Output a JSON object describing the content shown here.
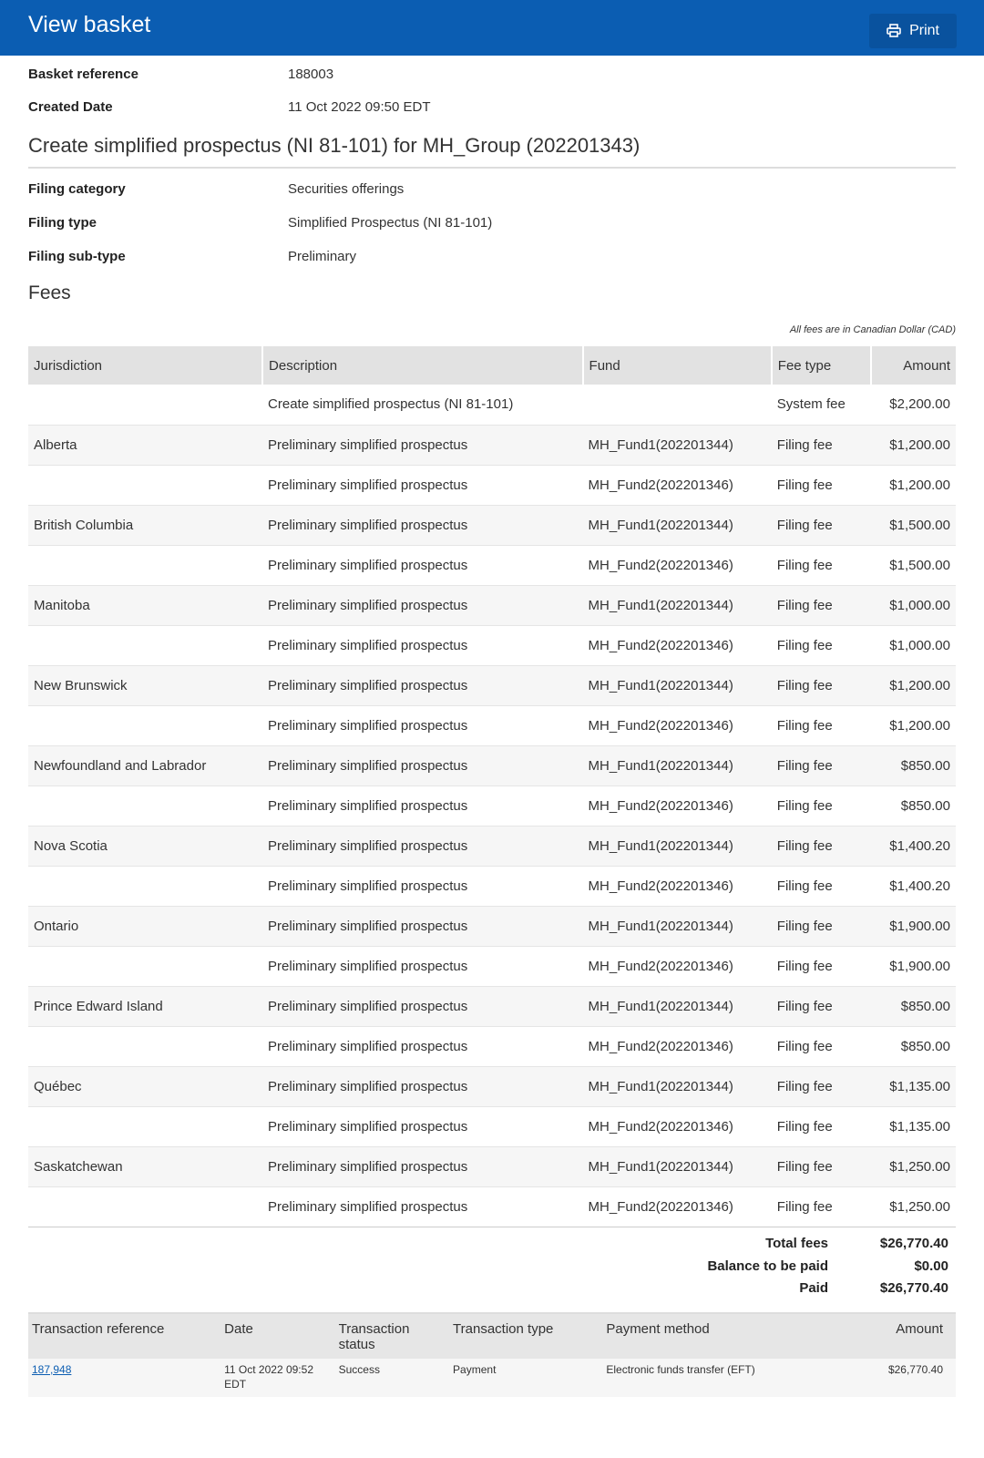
{
  "header": {
    "title": "View basket",
    "print_label": "Print"
  },
  "basket": {
    "reference_label": "Basket reference",
    "reference_value": "188003",
    "created_label": "Created Date",
    "created_value": "11 Oct 2022 09:50 EDT"
  },
  "filing": {
    "title": "Create simplified prospectus (NI 81-101) for MH_Group (202201343)",
    "category_label": "Filing category",
    "category_value": "Securities offerings",
    "type_label": "Filing type",
    "type_value": "Simplified Prospectus (NI 81-101)",
    "subtype_label": "Filing sub-type",
    "subtype_value": "Preliminary"
  },
  "fees": {
    "title": "Fees",
    "currency_note": "All fees are in Canadian Dollar (CAD)",
    "columns": [
      "Jurisdiction",
      "Description",
      "Fund",
      "Fee type",
      "Amount"
    ],
    "rows": [
      [
        "",
        "Create simplified prospectus (NI 81-101)",
        "",
        "System fee",
        "$2,200.00"
      ],
      [
        "Alberta",
        "Preliminary simplified prospectus",
        "MH_Fund1(202201344)",
        "Filing fee",
        "$1,200.00"
      ],
      [
        "",
        "Preliminary simplified prospectus",
        "MH_Fund2(202201346)",
        "Filing fee",
        "$1,200.00"
      ],
      [
        "British Columbia",
        "Preliminary simplified prospectus",
        "MH_Fund1(202201344)",
        "Filing fee",
        "$1,500.00"
      ],
      [
        "",
        "Preliminary simplified prospectus",
        "MH_Fund2(202201346)",
        "Filing fee",
        "$1,500.00"
      ],
      [
        "Manitoba",
        "Preliminary simplified prospectus",
        "MH_Fund1(202201344)",
        "Filing fee",
        "$1,000.00"
      ],
      [
        "",
        "Preliminary simplified prospectus",
        "MH_Fund2(202201346)",
        "Filing fee",
        "$1,000.00"
      ],
      [
        "New Brunswick",
        "Preliminary simplified prospectus",
        "MH_Fund1(202201344)",
        "Filing fee",
        "$1,200.00"
      ],
      [
        "",
        "Preliminary simplified prospectus",
        "MH_Fund2(202201346)",
        "Filing fee",
        "$1,200.00"
      ],
      [
        "Newfoundland and Labrador",
        "Preliminary simplified prospectus",
        "MH_Fund1(202201344)",
        "Filing fee",
        "$850.00"
      ],
      [
        "",
        "Preliminary simplified prospectus",
        "MH_Fund2(202201346)",
        "Filing fee",
        "$850.00"
      ],
      [
        "Nova Scotia",
        "Preliminary simplified prospectus",
        "MH_Fund1(202201344)",
        "Filing fee",
        "$1,400.20"
      ],
      [
        "",
        "Preliminary simplified prospectus",
        "MH_Fund2(202201346)",
        "Filing fee",
        "$1,400.20"
      ],
      [
        "Ontario",
        "Preliminary simplified prospectus",
        "MH_Fund1(202201344)",
        "Filing fee",
        "$1,900.00"
      ],
      [
        "",
        "Preliminary simplified prospectus",
        "MH_Fund2(202201346)",
        "Filing fee",
        "$1,900.00"
      ],
      [
        "Prince Edward Island",
        "Preliminary simplified prospectus",
        "MH_Fund1(202201344)",
        "Filing fee",
        "$850.00"
      ],
      [
        "",
        "Preliminary simplified prospectus",
        "MH_Fund2(202201346)",
        "Filing fee",
        "$850.00"
      ],
      [
        "Québec",
        "Preliminary simplified prospectus",
        "MH_Fund1(202201344)",
        "Filing fee",
        "$1,135.00"
      ],
      [
        "",
        "Preliminary simplified prospectus",
        "MH_Fund2(202201346)",
        "Filing fee",
        "$1,135.00"
      ],
      [
        "Saskatchewan",
        "Preliminary simplified prospectus",
        "MH_Fund1(202201344)",
        "Filing fee",
        "$1,250.00"
      ],
      [
        "",
        "Preliminary simplified prospectus",
        "MH_Fund2(202201346)",
        "Filing fee",
        "$1,250.00"
      ]
    ]
  },
  "totals": {
    "total_label": "Total fees",
    "total_value": "$26,770.40",
    "balance_label": "Balance to be paid",
    "balance_value": "$0.00",
    "paid_label": "Paid",
    "paid_value": "$26,770.40"
  },
  "transactions": {
    "columns": [
      "Transaction reference",
      "Date",
      "Transaction status",
      "Transaction type",
      "Payment method",
      "Amount"
    ],
    "rows": [
      {
        "reference": "187,948",
        "date": "11 Oct 2022 09:52 EDT",
        "status": "Success",
        "type": "Payment",
        "method": "Electronic funds transfer (EFT)",
        "amount": "$26,770.40"
      }
    ]
  },
  "colors": {
    "header_bg": "#0b5db2",
    "print_button_bg": "#09529e",
    "link": "#0b5db2"
  },
  "icons": {
    "print": "printer-icon"
  }
}
